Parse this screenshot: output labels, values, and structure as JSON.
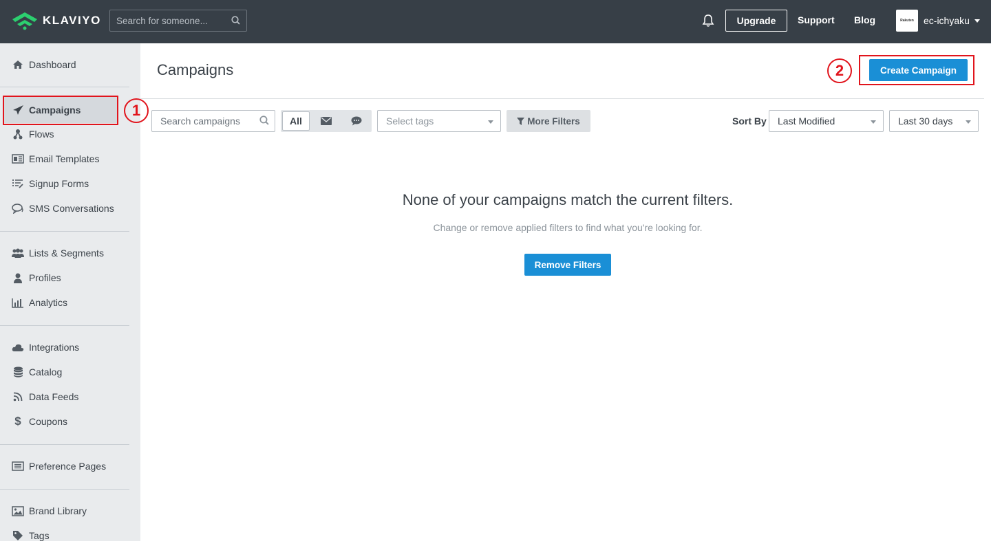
{
  "header": {
    "logo_text": "KLAVIYO",
    "search_placeholder": "Search for someone...",
    "upgrade_label": "Upgrade",
    "support_label": "Support",
    "blog_label": "Blog",
    "account_name": "ec-ichyaku",
    "account_logo_text": "Rakuten"
  },
  "sidebar": {
    "items": [
      {
        "label": "Dashboard",
        "icon": "home-icon"
      },
      {
        "label": "Campaigns",
        "icon": "paper-plane-icon"
      },
      {
        "label": "Flows",
        "icon": "flow-icon"
      },
      {
        "label": "Email Templates",
        "icon": "template-icon"
      },
      {
        "label": "Signup Forms",
        "icon": "form-icon"
      },
      {
        "label": "SMS Conversations",
        "icon": "chat-icon"
      },
      {
        "label": "Lists & Segments",
        "icon": "users-icon"
      },
      {
        "label": "Profiles",
        "icon": "user-icon"
      },
      {
        "label": "Analytics",
        "icon": "bar-chart-icon"
      },
      {
        "label": "Integrations",
        "icon": "cloud-icon"
      },
      {
        "label": "Catalog",
        "icon": "database-icon"
      },
      {
        "label": "Data Feeds",
        "icon": "rss-icon"
      },
      {
        "label": "Coupons",
        "icon": "dollar-icon"
      },
      {
        "label": "Preference Pages",
        "icon": "list-page-icon"
      },
      {
        "label": "Brand Library",
        "icon": "image-icon"
      },
      {
        "label": "Tags",
        "icon": "tag-icon"
      }
    ]
  },
  "annotations": {
    "marker_1": "1",
    "marker_2": "2"
  },
  "main": {
    "title": "Campaigns",
    "create_button": "Create Campaign",
    "search_placeholder": "Search campaigns",
    "filter_all": "All",
    "tags_placeholder": "Select tags",
    "more_filters": "More Filters",
    "sort_by_label": "Sort By",
    "sort_value": "Last Modified",
    "date_range": "Last 30 days",
    "empty_title": "None of your campaigns match the current filters.",
    "empty_subtitle": "Change or remove applied filters to find what you're looking for.",
    "remove_filters": "Remove Filters"
  },
  "colors": {
    "topbar": "#373f47",
    "sidebar": "#e9ebed",
    "primary": "#1a8fd6",
    "annotation": "#e1141c",
    "logo_green": "#2ccf6f"
  }
}
